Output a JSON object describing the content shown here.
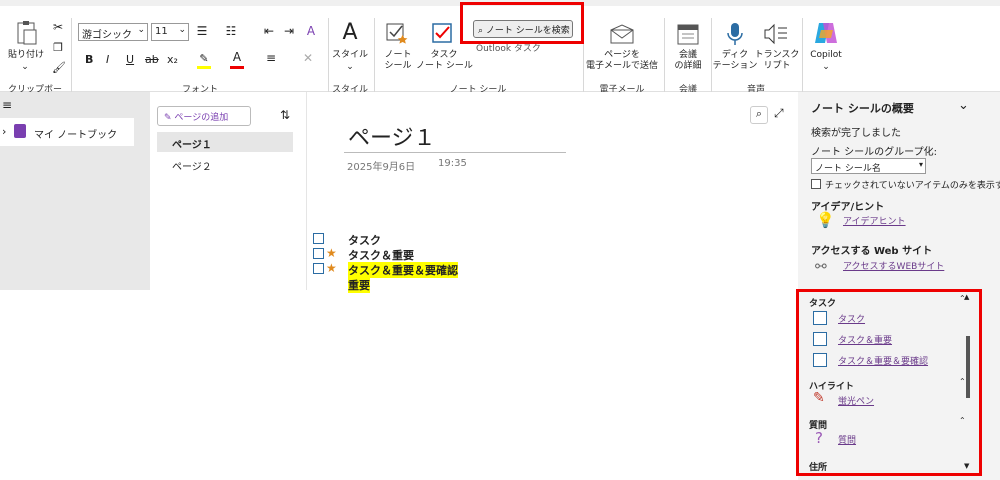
{
  "ribbon": {
    "clipboard": {
      "paste_label": "貼り付け",
      "group": "クリップボード"
    },
    "font": {
      "family": "游ゴシック",
      "size": "11",
      "group": "フォント",
      "bold": "B",
      "italic": "I",
      "underline": "U",
      "strike": "ab",
      "sub": "x₂"
    },
    "style": {
      "label": "スタイル",
      "group": "スタイル"
    },
    "tags": {
      "note_tag": "ノート\nシール",
      "task_tag": "タスク\nノート シール",
      "find_tags": "ノート シールを検索",
      "outlook": "Outlook タスク",
      "group": "ノート シール"
    },
    "email": {
      "label": "ページを\n電子メールで送信",
      "group": "電子メール"
    },
    "meeting": {
      "label": "会議\nの詳細",
      "group": "会議"
    },
    "voice": {
      "dictate": "ディク\nテーション",
      "transcribe": "トランスク\nリプト",
      "group": "音声"
    },
    "copilot": {
      "label": "Copilot"
    }
  },
  "notebook": {
    "name": "マイ ノートブック"
  },
  "pages": {
    "add_label": "ページの追加",
    "items": [
      "ページ１",
      "ページ２"
    ]
  },
  "page": {
    "title": "ページ１",
    "date": "2025年9月6日",
    "time": "19:35",
    "tasks": [
      {
        "text": "タスク",
        "star": false,
        "highlight": false
      },
      {
        "text": "タスク＆重要",
        "star": true,
        "highlight": false
      },
      {
        "text": "タスク＆重要＆要確認",
        "star": true,
        "highlight": true
      },
      {
        "text": "重要",
        "star": false,
        "highlight": true
      }
    ]
  },
  "summary": {
    "title": "ノート シールの概要",
    "status": "検索が完了しました",
    "group_by_label": "ノート シールのグループ化:",
    "group_by_value": "ノート シール名",
    "unchecked_only": "チェックされていないアイテムのみを表示す",
    "idea_heading": "アイデア/ヒント",
    "idea_link": "アイデアヒント",
    "website_heading": "アクセスする Web サイト",
    "website_link": "アクセスするWEBサイト",
    "task_heading": "タスク",
    "task_items": [
      "タスク",
      "タスク＆重要",
      "タスク＆重要＆要確認"
    ],
    "highlight_heading": "ハイライト",
    "highlight_link": "蛍光ペン",
    "question_heading": "質問",
    "question_link": "質問",
    "address_heading": "住所"
  },
  "colors": {
    "accent_purple": "#7a3fb0",
    "highlight": "#ffff00",
    "annotation_red": "#e00000",
    "star": "#e08a1e"
  }
}
